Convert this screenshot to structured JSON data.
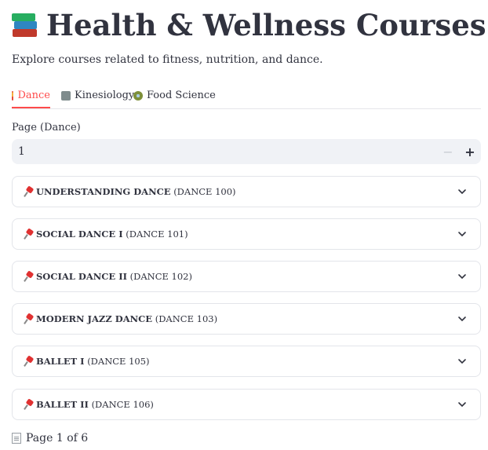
{
  "header": {
    "title": "Health & Wellness Courses",
    "title_icon": "books-icon",
    "subtitle": "Explore courses related to fitness, nutrition, and dance."
  },
  "tabs": [
    {
      "label": "Dance",
      "icon": "dancer-icon",
      "active": true
    },
    {
      "label": "Kinesiology",
      "icon": "weightlifter-icon",
      "active": false
    },
    {
      "label": "Food Science",
      "icon": "salad-icon",
      "active": false
    }
  ],
  "pager": {
    "label": "Page (Dance)",
    "value": "1",
    "minus": "−",
    "plus": "+"
  },
  "courses": [
    {
      "name": "UNDERSTANDING DANCE",
      "code": "(DANCE 100)"
    },
    {
      "name": "SOCIAL DANCE I",
      "code": "(DANCE 101)"
    },
    {
      "name": "SOCIAL DANCE II",
      "code": "(DANCE 102)"
    },
    {
      "name": "MODERN JAZZ DANCE",
      "code": "(DANCE 103)"
    },
    {
      "name": "BALLET I",
      "code": "(DANCE 105)"
    },
    {
      "name": "BALLET II",
      "code": "(DANCE 106)"
    }
  ],
  "footer": {
    "text": "Page 1 of 6",
    "icon": "page-icon"
  },
  "colors": {
    "accent": "#ff4b4b",
    "text": "#31333f",
    "input_bg": "#f0f2f6"
  }
}
